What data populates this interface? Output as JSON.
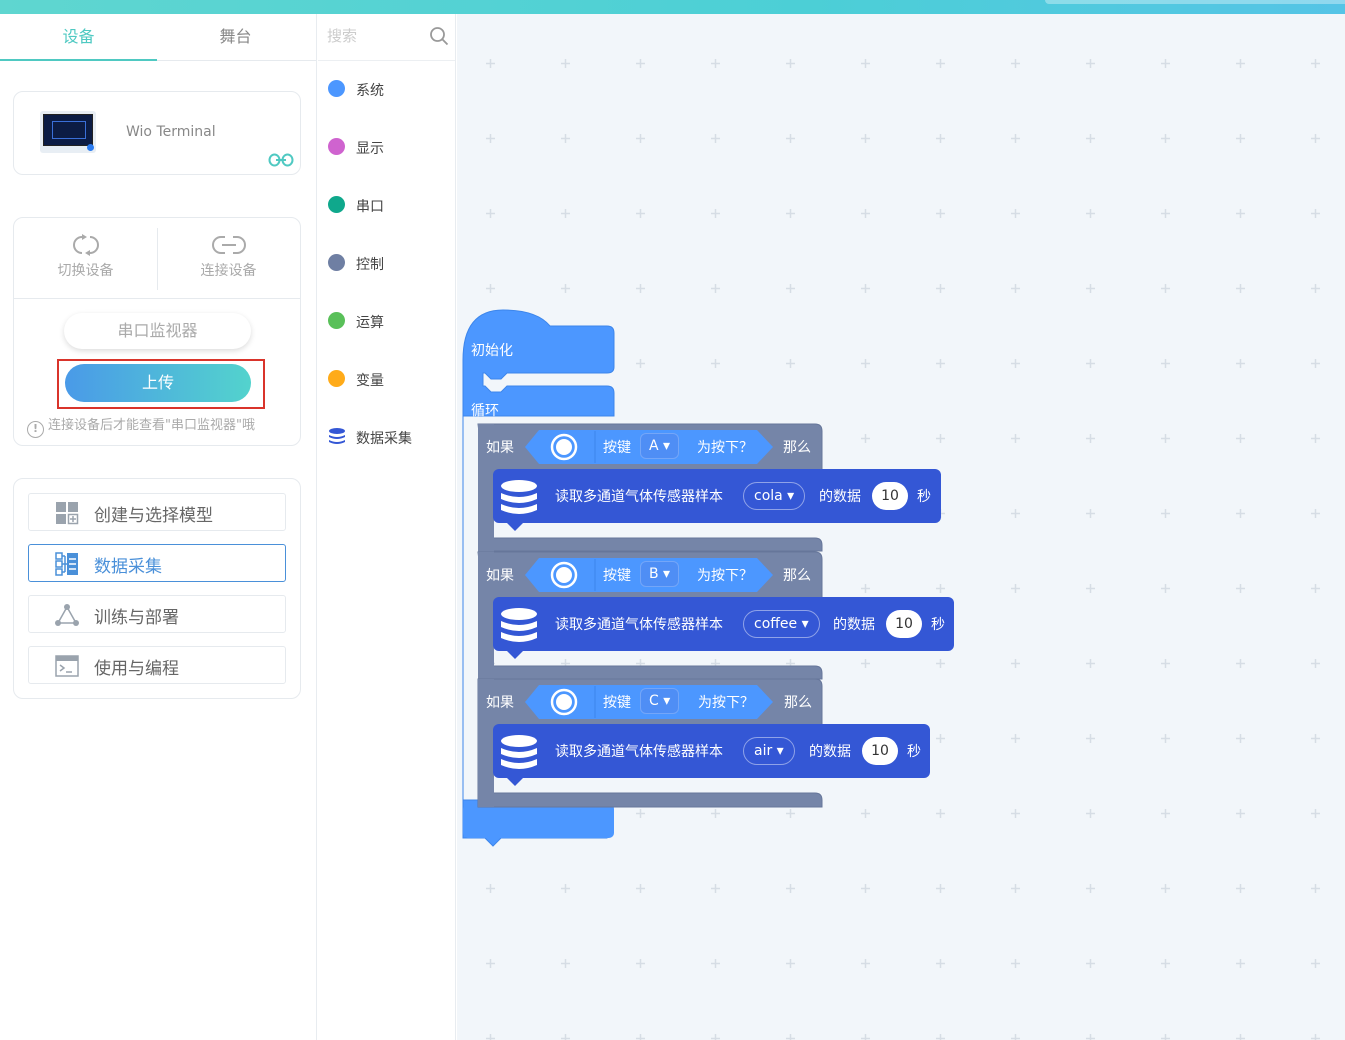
{
  "tabs": {
    "device": "设备",
    "stage": "舞台"
  },
  "device": {
    "name": "Wio Terminal"
  },
  "actions": {
    "switch_label": "切换设备",
    "connect_label": "连接设备",
    "serial_monitor": "串口监视器",
    "upload": "上传",
    "notice": "连接设备后才能查看\"串口监视器\"哦"
  },
  "menu": {
    "items": [
      {
        "label": "创建与选择模型",
        "icon": "model-icon",
        "active": false
      },
      {
        "label": "数据采集",
        "icon": "data-collect-icon",
        "active": true
      },
      {
        "label": "训练与部署",
        "icon": "train-icon",
        "active": false
      },
      {
        "label": "使用与编程",
        "icon": "terminal-icon",
        "active": false
      }
    ]
  },
  "search": {
    "placeholder": "搜索"
  },
  "categories": [
    {
      "label": "系统",
      "color": "#4c97ff"
    },
    {
      "label": "显示",
      "color": "#cf63cf"
    },
    {
      "label": "串口",
      "color": "#0fa88c"
    },
    {
      "label": "控制",
      "color": "#6f7fa3"
    },
    {
      "label": "运算",
      "color": "#59c059"
    },
    {
      "label": "变量",
      "color": "#ffab19"
    },
    {
      "label": "数据采集",
      "color": "#3457d5",
      "icon": "database-icon"
    }
  ],
  "colors": {
    "event_block": "#4c97ff",
    "control_block": "#7585a8",
    "sensor_block": "#3457d5",
    "accent": "#4fc9c2",
    "highlight_border": "#d9342b"
  },
  "blocks": {
    "init": "初始化",
    "loop": "循环",
    "ifs": [
      {
        "if": "如果",
        "key_label": "按键",
        "key": "A",
        "pressed": "为按下？",
        "then": "那么",
        "read": "读取多通道气体传感器样本",
        "sample": "cola",
        "of_data": "的数据",
        "seconds": "10",
        "sec_unit": "秒"
      },
      {
        "if": "如果",
        "key_label": "按键",
        "key": "B",
        "pressed": "为按下？",
        "then": "那么",
        "read": "读取多通道气体传感器样本",
        "sample": "coffee",
        "of_data": "的数据",
        "seconds": "10",
        "sec_unit": "秒"
      },
      {
        "if": "如果",
        "key_label": "按键",
        "key": "C",
        "pressed": "为按下？",
        "then": "那么",
        "read": "读取多通道气体传感器样本",
        "sample": "air",
        "of_data": "的数据",
        "seconds": "10",
        "sec_unit": "秒"
      }
    ]
  }
}
